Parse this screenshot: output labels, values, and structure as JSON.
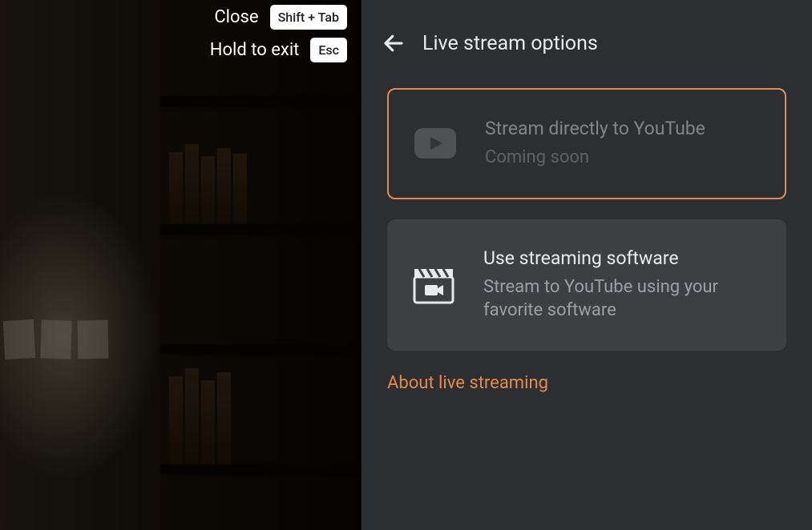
{
  "hints": {
    "close_label": "Close",
    "close_key": "Shift + Tab",
    "exit_label": "Hold to exit",
    "exit_key": "Esc"
  },
  "header": {
    "title": "Live stream options"
  },
  "options": {
    "youtube": {
      "title": "Stream directly to YouTube",
      "subtitle": "Coming soon"
    },
    "software": {
      "title": "Use streaming software",
      "subtitle": "Stream to YouTube using your favorite software"
    }
  },
  "about_link": "About live streaming",
  "colors": {
    "accent": "#e38b4f",
    "panel_bg": "#2d2e31",
    "card_bg": "#3c4043",
    "text_primary": "#e8eaed",
    "text_secondary": "#9aa0a6"
  }
}
